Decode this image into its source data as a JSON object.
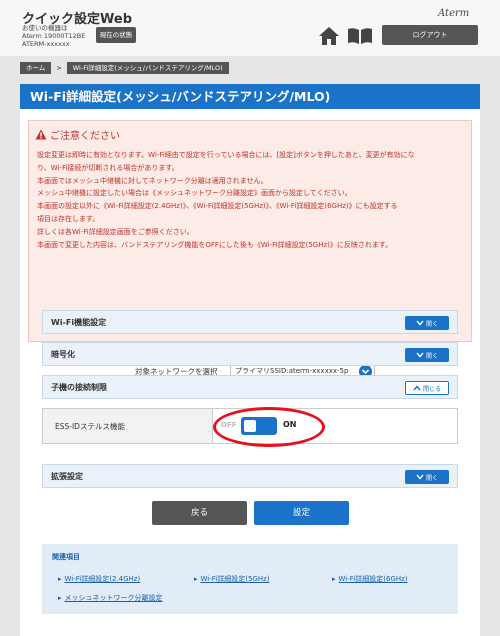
{
  "header": {
    "app_title": "クイック設定Web",
    "device_label": "お使いの機器は",
    "device_model": "Aterm 19000T12BE",
    "device_name": "ATERM-xxxxxx",
    "status_button": "現在の状態",
    "brand": "Aterm",
    "logout_button": "ログアウト",
    "home_icon": "home-icon",
    "manual_icon": "book-icon"
  },
  "breadcrumb": {
    "home": "ホーム",
    "separator": ">",
    "current": "Wi-Fi詳細設定(メッシュ/バンドステアリング/MLO)"
  },
  "page": {
    "title": "Wi-Fi詳細設定(メッシュ/バンドステアリング/MLO)"
  },
  "caution": {
    "title": "ご注意ください",
    "lines": [
      "設定変更は即時に有効となります。Wi-Fi経由で設定を行っている場合には、[設定]ボタンを押したあと、変更が有効にな",
      "り、Wi-Fi接続が切断される場合があります。",
      "本画面ではメッシュ中継機に対してネットワーク分離は適用されません。",
      "メッシュ中継機に設定したい場合は《メッシュネットワーク分離設定》画面から設定してください。",
      "本画面の設定以外に《Wi-Fi詳細設定(2.4GHz)》、《Wi-Fi詳細設定(5GHz)》、《Wi-Fi詳細設定(6GHz)》にも設定する",
      "項目は存在します。",
      "詳しくは各Wi-Fi詳細設定画面をご参照ください。",
      "本画面で変更した内容は、バンドステアリング機能をOFFにした後も《Wi-Fi詳細設定(5GHz)》に反映されます。"
    ]
  },
  "network_select": {
    "label": "対象ネットワークを選択",
    "value": "プライマリSSID:aterm-xxxxxx-5p"
  },
  "sections": {
    "wifi_function": {
      "label": "Wi-Fi機能設定",
      "button": "開く"
    },
    "encryption": {
      "label": "暗号化",
      "button": "開く"
    },
    "client_limit": {
      "label": "子機の接続制限",
      "button": "閉じる"
    },
    "extended": {
      "label": "拡張設定",
      "button": "開く"
    }
  },
  "ess_stealth": {
    "label": "ESS-IDステルス機能",
    "off": "OFF",
    "on": "ON",
    "state": "on"
  },
  "actions": {
    "back": "戻る",
    "apply": "設定"
  },
  "related": {
    "title": "関連項目",
    "links": [
      "Wi-Fi詳細設定(2.4GHz)",
      "Wi-Fi詳細設定(5GHz)",
      "Wi-Fi詳細設定(6GHz)",
      "メッシュネットワーク分離設定"
    ]
  },
  "colors": {
    "accent": "#1a73c8",
    "caution_text": "#c0342a",
    "highlight": "#e8101c",
    "dark_button": "#555555"
  }
}
